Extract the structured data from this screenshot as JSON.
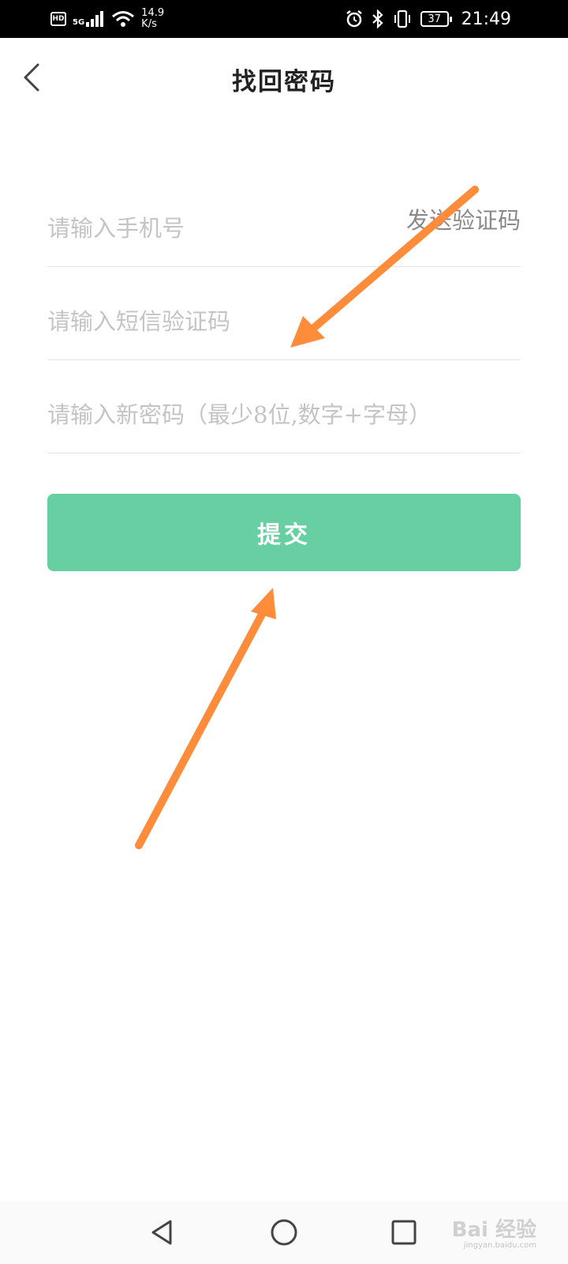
{
  "status_bar": {
    "hd": "HD",
    "network": "5G",
    "speed_value": "14.9",
    "speed_unit": "K/s",
    "battery": "37",
    "time": "21:49"
  },
  "header": {
    "title": "找回密码"
  },
  "form": {
    "phone_placeholder": "请输入手机号",
    "send_code_label": "发送验证码",
    "sms_placeholder": "请输入短信验证码",
    "password_placeholder": "请输入新密码（最少8位,数字+字母）",
    "submit_label": "提交"
  },
  "annotation": {
    "arrow_color": "#ff8c3a"
  },
  "watermark": {
    "brand": "Bai 经验",
    "url": "jingyan.baidu.com"
  },
  "colors": {
    "accent": "#67cfa2"
  }
}
